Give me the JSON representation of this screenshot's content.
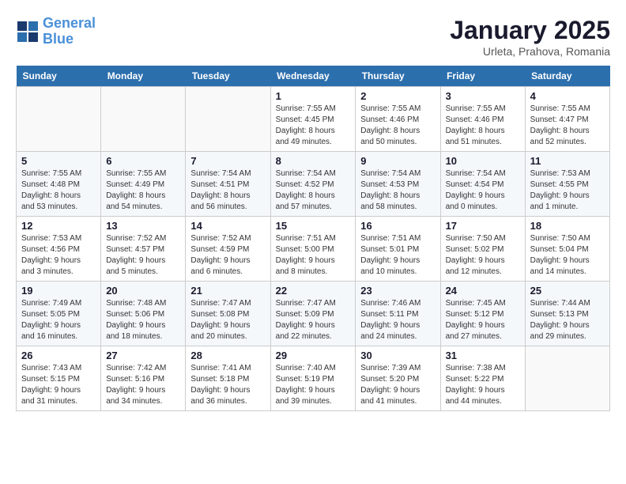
{
  "logo": {
    "line1": "General",
    "line2": "Blue"
  },
  "title": "January 2025",
  "location": "Urleta, Prahova, Romania",
  "weekdays": [
    "Sunday",
    "Monday",
    "Tuesday",
    "Wednesday",
    "Thursday",
    "Friday",
    "Saturday"
  ],
  "weeks": [
    [
      {
        "day": "",
        "detail": ""
      },
      {
        "day": "",
        "detail": ""
      },
      {
        "day": "",
        "detail": ""
      },
      {
        "day": "1",
        "detail": "Sunrise: 7:55 AM\nSunset: 4:45 PM\nDaylight: 8 hours\nand 49 minutes."
      },
      {
        "day": "2",
        "detail": "Sunrise: 7:55 AM\nSunset: 4:46 PM\nDaylight: 8 hours\nand 50 minutes."
      },
      {
        "day": "3",
        "detail": "Sunrise: 7:55 AM\nSunset: 4:46 PM\nDaylight: 8 hours\nand 51 minutes."
      },
      {
        "day": "4",
        "detail": "Sunrise: 7:55 AM\nSunset: 4:47 PM\nDaylight: 8 hours\nand 52 minutes."
      }
    ],
    [
      {
        "day": "5",
        "detail": "Sunrise: 7:55 AM\nSunset: 4:48 PM\nDaylight: 8 hours\nand 53 minutes."
      },
      {
        "day": "6",
        "detail": "Sunrise: 7:55 AM\nSunset: 4:49 PM\nDaylight: 8 hours\nand 54 minutes."
      },
      {
        "day": "7",
        "detail": "Sunrise: 7:54 AM\nSunset: 4:51 PM\nDaylight: 8 hours\nand 56 minutes."
      },
      {
        "day": "8",
        "detail": "Sunrise: 7:54 AM\nSunset: 4:52 PM\nDaylight: 8 hours\nand 57 minutes."
      },
      {
        "day": "9",
        "detail": "Sunrise: 7:54 AM\nSunset: 4:53 PM\nDaylight: 8 hours\nand 58 minutes."
      },
      {
        "day": "10",
        "detail": "Sunrise: 7:54 AM\nSunset: 4:54 PM\nDaylight: 9 hours\nand 0 minutes."
      },
      {
        "day": "11",
        "detail": "Sunrise: 7:53 AM\nSunset: 4:55 PM\nDaylight: 9 hours\nand 1 minute."
      }
    ],
    [
      {
        "day": "12",
        "detail": "Sunrise: 7:53 AM\nSunset: 4:56 PM\nDaylight: 9 hours\nand 3 minutes."
      },
      {
        "day": "13",
        "detail": "Sunrise: 7:52 AM\nSunset: 4:57 PM\nDaylight: 9 hours\nand 5 minutes."
      },
      {
        "day": "14",
        "detail": "Sunrise: 7:52 AM\nSunset: 4:59 PM\nDaylight: 9 hours\nand 6 minutes."
      },
      {
        "day": "15",
        "detail": "Sunrise: 7:51 AM\nSunset: 5:00 PM\nDaylight: 9 hours\nand 8 minutes."
      },
      {
        "day": "16",
        "detail": "Sunrise: 7:51 AM\nSunset: 5:01 PM\nDaylight: 9 hours\nand 10 minutes."
      },
      {
        "day": "17",
        "detail": "Sunrise: 7:50 AM\nSunset: 5:02 PM\nDaylight: 9 hours\nand 12 minutes."
      },
      {
        "day": "18",
        "detail": "Sunrise: 7:50 AM\nSunset: 5:04 PM\nDaylight: 9 hours\nand 14 minutes."
      }
    ],
    [
      {
        "day": "19",
        "detail": "Sunrise: 7:49 AM\nSunset: 5:05 PM\nDaylight: 9 hours\nand 16 minutes."
      },
      {
        "day": "20",
        "detail": "Sunrise: 7:48 AM\nSunset: 5:06 PM\nDaylight: 9 hours\nand 18 minutes."
      },
      {
        "day": "21",
        "detail": "Sunrise: 7:47 AM\nSunset: 5:08 PM\nDaylight: 9 hours\nand 20 minutes."
      },
      {
        "day": "22",
        "detail": "Sunrise: 7:47 AM\nSunset: 5:09 PM\nDaylight: 9 hours\nand 22 minutes."
      },
      {
        "day": "23",
        "detail": "Sunrise: 7:46 AM\nSunset: 5:11 PM\nDaylight: 9 hours\nand 24 minutes."
      },
      {
        "day": "24",
        "detail": "Sunrise: 7:45 AM\nSunset: 5:12 PM\nDaylight: 9 hours\nand 27 minutes."
      },
      {
        "day": "25",
        "detail": "Sunrise: 7:44 AM\nSunset: 5:13 PM\nDaylight: 9 hours\nand 29 minutes."
      }
    ],
    [
      {
        "day": "26",
        "detail": "Sunrise: 7:43 AM\nSunset: 5:15 PM\nDaylight: 9 hours\nand 31 minutes."
      },
      {
        "day": "27",
        "detail": "Sunrise: 7:42 AM\nSunset: 5:16 PM\nDaylight: 9 hours\nand 34 minutes."
      },
      {
        "day": "28",
        "detail": "Sunrise: 7:41 AM\nSunset: 5:18 PM\nDaylight: 9 hours\nand 36 minutes."
      },
      {
        "day": "29",
        "detail": "Sunrise: 7:40 AM\nSunset: 5:19 PM\nDaylight: 9 hours\nand 39 minutes."
      },
      {
        "day": "30",
        "detail": "Sunrise: 7:39 AM\nSunset: 5:20 PM\nDaylight: 9 hours\nand 41 minutes."
      },
      {
        "day": "31",
        "detail": "Sunrise: 7:38 AM\nSunset: 5:22 PM\nDaylight: 9 hours\nand 44 minutes."
      },
      {
        "day": "",
        "detail": ""
      }
    ]
  ]
}
